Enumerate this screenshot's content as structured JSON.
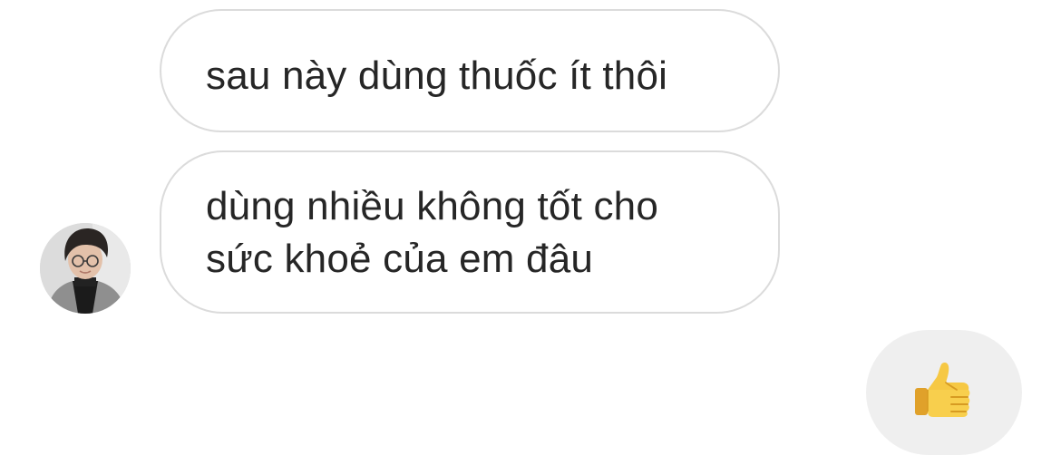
{
  "conversation": {
    "messages": [
      {
        "lines": [
          "sau này dùng thuốc ít thôi"
        ]
      },
      {
        "lines": [
          "dùng nhiều không tốt cho",
          "sức khoẻ của em đâu"
        ]
      }
    ],
    "reply": {
      "icon": "thumbs-up-icon"
    }
  },
  "colors": {
    "bubble_border": "#dbdbdb",
    "text": "#262626",
    "reaction_bubble_bg": "#efefef"
  }
}
